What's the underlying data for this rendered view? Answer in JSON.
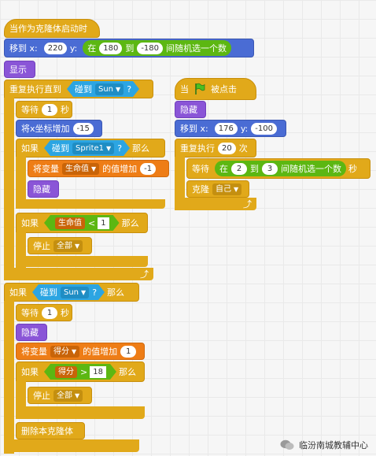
{
  "script1": {
    "hat": "当作为克隆体启动时",
    "goto": {
      "label_a": "移到 x:",
      "x": "220",
      "label_b": "y:",
      "in": "在",
      "min": "180",
      "to": "到",
      "max": "-180",
      "suffix": "间随机选一个数"
    },
    "show": "显示",
    "repeat_until": {
      "label": "重复执行直到",
      "touch": "碰到",
      "target": "Sun",
      "q": "?"
    },
    "wait1": {
      "label": "等待",
      "val": "1",
      "unit": "秒"
    },
    "change_x": {
      "label": "将x坐标增加",
      "val": "-15"
    },
    "if1": {
      "label": "如果",
      "touch": "碰到",
      "target": "Sprite1",
      "q": "?",
      "then": "那么"
    },
    "change_var1": {
      "label": "将变量",
      "var": "生命值",
      "mid": "的值增加",
      "val": "-1"
    },
    "hide1": "隐藏",
    "if2": {
      "label": "如果",
      "var": "生命值",
      "op": "<",
      "val": "1",
      "then": "那么"
    },
    "stop1": {
      "label": "停止",
      "opt": "全部"
    },
    "if3": {
      "label": "如果",
      "touch": "碰到",
      "target": "Sun",
      "q": "?",
      "then": "那么"
    },
    "wait2": {
      "label": "等待",
      "val": "1",
      "unit": "秒"
    },
    "hide2": "隐藏",
    "change_var2": {
      "label": "将变量",
      "var": "得分",
      "mid": "的值增加",
      "val": "1"
    },
    "if4": {
      "label": "如果",
      "var": "得分",
      "op": ">",
      "val": "18",
      "then": "那么"
    },
    "stop2": {
      "label": "停止",
      "opt": "全部"
    },
    "delete_clone": "删除本克隆体"
  },
  "script2": {
    "hat": {
      "when": "当",
      "clicked": "被点击"
    },
    "hide": "隐藏",
    "goto": {
      "label_a": "移到 x:",
      "x": "176",
      "label_b": "y:",
      "y": "-100"
    },
    "repeat": {
      "label": "重复执行",
      "val": "20",
      "unit": "次"
    },
    "wait": {
      "label": "等待",
      "in": "在",
      "min": "2",
      "to": "到",
      "max": "3",
      "suffix": "间随机选一个数",
      "unit": "秒"
    },
    "clone": {
      "label": "克隆",
      "opt": "自己"
    }
  },
  "watermark": "临汾南城教辅中心",
  "colors": {
    "control": "#e1a91a",
    "looks": "#8a55d7",
    "motion": "#4a6cd4",
    "sensing": "#2ca5e2",
    "data": "#ee7d16",
    "operators": "#5cb712",
    "events": "#e1a91a"
  }
}
